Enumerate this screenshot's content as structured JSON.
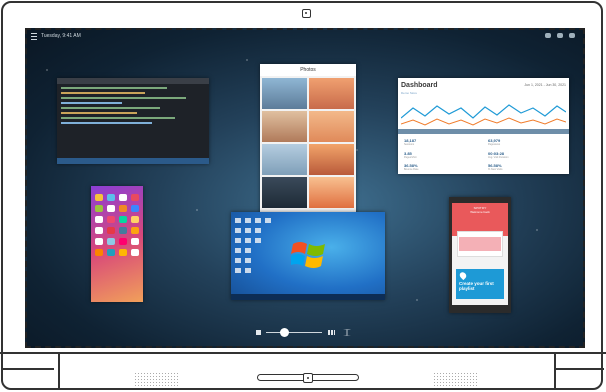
{
  "topbar": {
    "title": "Tuesday, 9:41 AM"
  },
  "windows": {
    "code_editor": {
      "name": "code-editor-window"
    },
    "photos": {
      "header": "Photos"
    },
    "dashboard": {
      "title": "Dashboard",
      "subtitle": "Demo Store",
      "range": "Jun 1, 2021 - Jun 30, 2021",
      "stats": [
        {
          "value": "18,187",
          "label": "Sessions"
        },
        {
          "value": "3.85",
          "label": "Pages/Visit"
        },
        {
          "value": "36.58%",
          "label": "Bounce Rate"
        },
        {
          "value": "63,979",
          "label": "Pageviews"
        },
        {
          "value": "00:03:28",
          "label": "Avg. Visit Duration"
        },
        {
          "value": "56.58%",
          "label": "% New Visits"
        }
      ]
    },
    "phone_app": {
      "brand": "SPOTIFY",
      "tagline": "Welcome back",
      "card_text": "Create your first playlist"
    }
  },
  "colors": {
    "wallpaper": "#23415a",
    "bezel": "#333333",
    "dashboard_line_1": "#1f9ad6",
    "dashboard_line_2": "#f07b2a"
  }
}
